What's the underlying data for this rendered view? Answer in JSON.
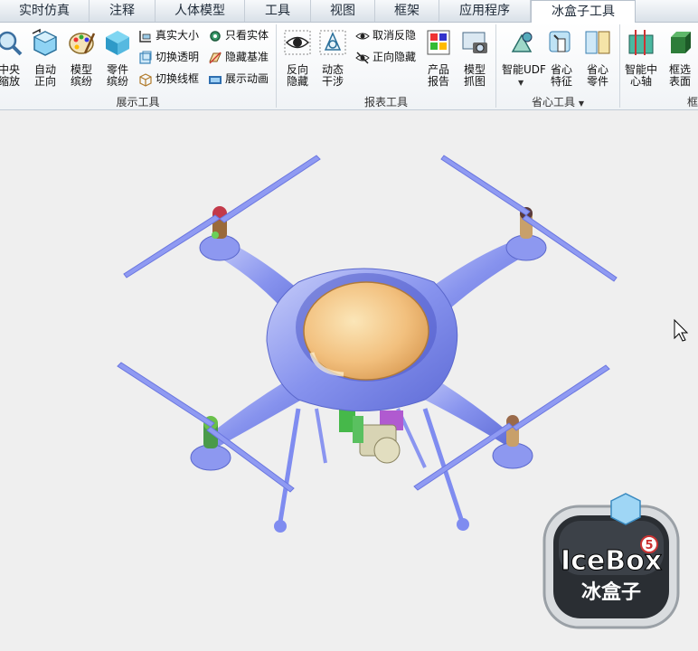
{
  "tabs": [
    "实时仿真",
    "注释",
    "人体模型",
    "工具",
    "视图",
    "框架",
    "应用程序",
    "冰盒子工具"
  ],
  "active_tab": "冰盒子工具",
  "groups": {
    "display_tools": {
      "label": "展示工具",
      "big_buttons": [
        {
          "line1": "中央",
          "line2": "缩放",
          "icon": "magnifier-icon"
        },
        {
          "line1": "自动",
          "line2": "正向",
          "icon": "cube-orient-icon"
        },
        {
          "line1": "模型",
          "line2": "缤纷",
          "icon": "palette-icon"
        },
        {
          "line1": "零件",
          "line2": "缤纷",
          "icon": "cube-color-icon"
        }
      ],
      "small_buttons": [
        {
          "label": "真实大小",
          "icon": "ruler-icon"
        },
        {
          "label": "切换透明",
          "icon": "transparent-cube-icon"
        },
        {
          "label": "切换线框",
          "icon": "wireframe-icon"
        },
        {
          "label": "只看实体",
          "icon": "solid-gear-icon"
        },
        {
          "label": "隐藏基准",
          "icon": "hide-datum-icon"
        },
        {
          "label": "展示动画",
          "icon": "animation-icon"
        }
      ]
    },
    "report_tools": {
      "label": "报表工具",
      "big_buttons": [
        {
          "line1": "反向",
          "line2": "隐藏",
          "icon": "eye-icon"
        },
        {
          "line1": "动态",
          "line2": "干涉",
          "icon": "interference-icon"
        },
        {
          "line1": "产品",
          "line2": "报告",
          "icon": "report-icon"
        },
        {
          "line1": "模型",
          "line2": "抓图",
          "icon": "camera-icon"
        }
      ],
      "small_buttons": [
        {
          "label": "取消反隐",
          "icon": "eye-small-icon"
        },
        {
          "label": "正向隐藏",
          "icon": "eye-hide-icon"
        }
      ]
    },
    "saving_tools": {
      "label": "省心工具",
      "big_buttons": [
        {
          "line1": "智能UDF",
          "line2": "",
          "icon": "udf-icon"
        },
        {
          "line1": "省心",
          "line2": "特征",
          "icon": "feature-icon"
        },
        {
          "line1": "省心",
          "line2": "零件",
          "icon": "part-book-icon"
        }
      ]
    },
    "frame_tools": {
      "big_buttons": [
        {
          "line1": "智能中",
          "line2": "心轴",
          "icon": "axis-icon"
        },
        {
          "line1": "框选",
          "line2": "表面",
          "icon": "surface-select-icon"
        }
      ]
    }
  },
  "logo": {
    "text": "IceBox",
    "version": "5",
    "sub": "冰盒子"
  },
  "colors": {
    "accent": "#7f8cf0",
    "canvas": "#efefef",
    "ribbon_label": "#333333"
  }
}
